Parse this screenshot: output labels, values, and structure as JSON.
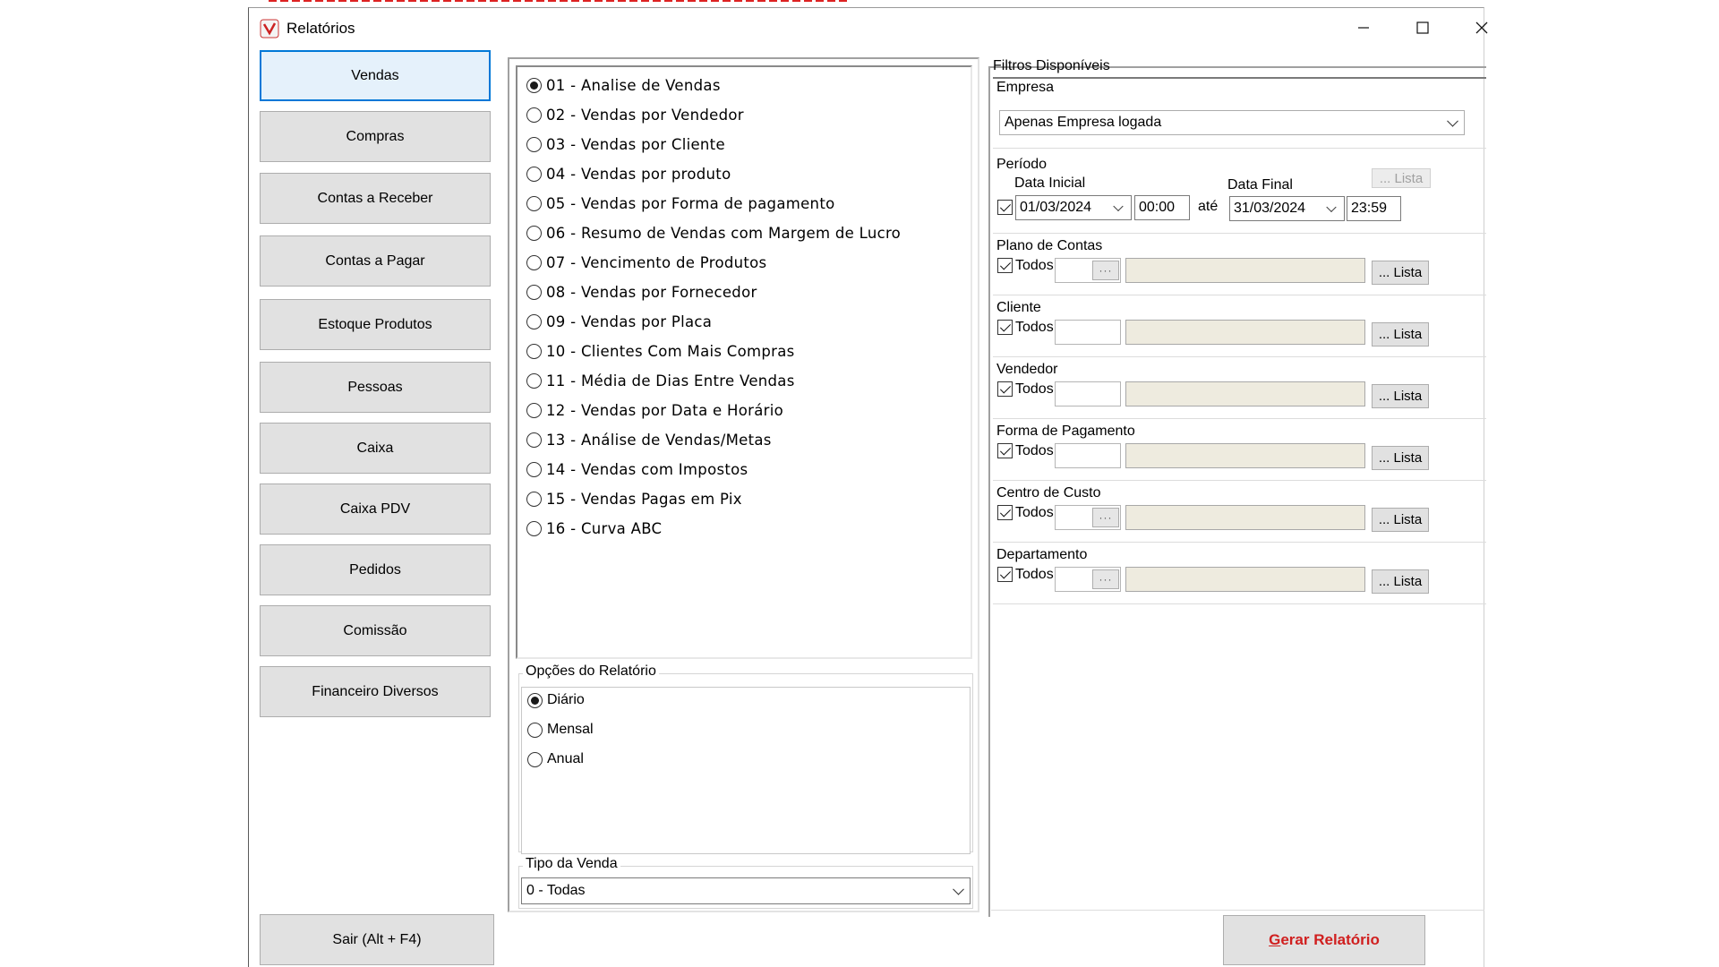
{
  "window": {
    "title": "Relatórios"
  },
  "nav": [
    {
      "label": "Vendas",
      "active": true
    },
    {
      "label": "Compras"
    },
    {
      "label": "Contas a Receber"
    },
    {
      "label": "Contas a Pagar"
    },
    {
      "label": "Estoque Produtos"
    },
    {
      "label": "Pessoas"
    },
    {
      "label": "Caixa"
    },
    {
      "label": "Caixa PDV"
    },
    {
      "label": "Pedidos"
    },
    {
      "label": "Comissão"
    },
    {
      "label": "Financeiro Diversos"
    }
  ],
  "exit_button": "Sair (Alt + F4)",
  "reports": [
    "01 - Analise de Vendas",
    "02 - Vendas por Vendedor",
    "03 - Vendas por Cliente",
    "04 - Vendas por produto",
    "05 - Vendas por Forma de pagamento",
    "06 - Resumo de Vendas com Margem de Lucro",
    "07 - Vencimento de Produtos",
    "08 - Vendas por Fornecedor",
    "09 - Vendas por Placa",
    "10 - Clientes Com Mais Compras",
    "11 - Média de Dias Entre Vendas",
    "12 - Vendas por Data e Horário",
    "13 - Análise de Vendas/Metas",
    "14 - Vendas com Impostos",
    "15 - Vendas Pagas em Pix",
    "16 - Curva ABC"
  ],
  "selected_report": "01 - Analise de Vendas",
  "options": {
    "title": "Opções do Relatório",
    "items": [
      "Diário",
      "Mensal",
      "Anual"
    ],
    "selected": "Diário"
  },
  "tipo_venda": {
    "title": "Tipo da Venda",
    "value": "0 - Todas"
  },
  "filters": {
    "title": "Filtros Disponíveis",
    "empresa": {
      "label": "Empresa",
      "value": "Apenas Empresa logada"
    },
    "periodo": {
      "label": "Período",
      "data_inicial_label": "Data Inicial",
      "data_final_label": "Data Final",
      "start_date": "01/03/2024",
      "start_time": "00:00",
      "ate": "até",
      "end_date": "31/03/2024",
      "end_time": "23:59",
      "lista": "... Lista",
      "checked": true
    },
    "groups": [
      {
        "label": "Plano de Contas",
        "todos": "Todos",
        "checked": true,
        "has_dots": true,
        "lista": "... Lista"
      },
      {
        "label": "Cliente",
        "todos": "Todos",
        "checked": true,
        "has_dots": false,
        "lista": "... Lista"
      },
      {
        "label": "Vendedor",
        "todos": "Todos",
        "checked": true,
        "has_dots": false,
        "lista": "... Lista"
      },
      {
        "label": "Forma de Pagamento",
        "todos": "Todos",
        "checked": true,
        "has_dots": false,
        "lista": "... Lista"
      },
      {
        "label": "Centro de Custo",
        "todos": "Todos",
        "checked": true,
        "has_dots": true,
        "lista": "... Lista"
      },
      {
        "label": "Departamento",
        "todos": "Todos",
        "checked": true,
        "has_dots": true,
        "lista": "... Lista"
      }
    ]
  },
  "generate_button": {
    "prefix": "G",
    "rest": "erar Relatório"
  },
  "colors": {
    "accent": "#0078d7",
    "generate_text": "#d01f1f",
    "readonly_field": "#eeebdf"
  }
}
